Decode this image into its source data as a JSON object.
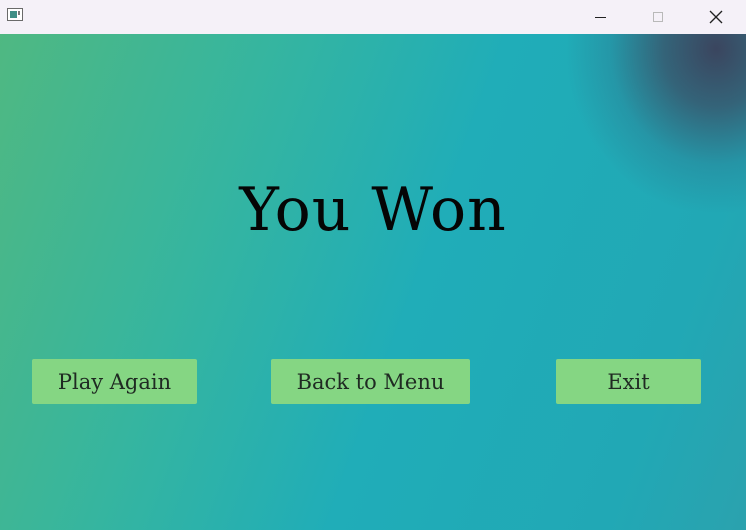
{
  "window": {
    "icons": {
      "app": "app-window-icon",
      "minimize": "minimize-icon",
      "maximize": "maximize-icon",
      "close": "close-icon"
    }
  },
  "main": {
    "title": "You Won",
    "buttons": {
      "play_again": "Play Again",
      "back_to_menu": "Back to Menu",
      "exit": "Exit"
    }
  },
  "colors": {
    "button_bg": "#85d683",
    "titlebar_bg": "#f5f1f8",
    "gradient_start": "#4fb882",
    "gradient_end": "#21a8b5",
    "corner_shade": "#3c405a"
  }
}
